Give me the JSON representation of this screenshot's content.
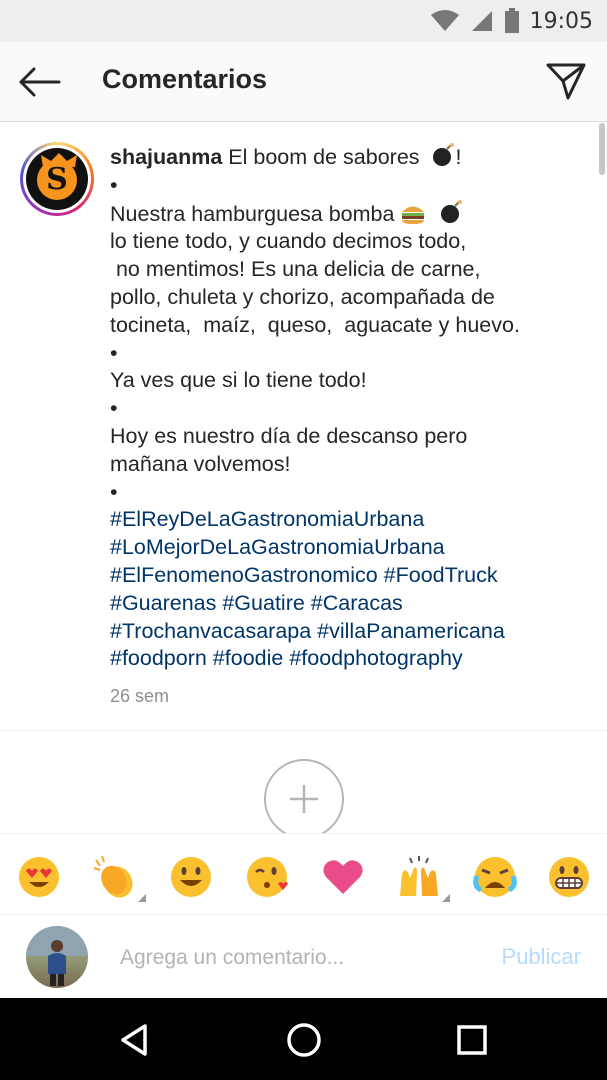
{
  "status_bar": {
    "time": "19:05"
  },
  "header": {
    "title": "Comentarios",
    "back_icon": "arrow-left-icon",
    "send_icon": "paper-plane-icon"
  },
  "caption": {
    "username": "shajuanma",
    "first_line_text": " El boom de sabores",
    "lines": [
      "•",
      "Nuestra hamburguesa bomba",
      "lo tiene todo, y cuando decimos todo,",
      " no mentimos! Es una delicia de carne,",
      "pollo, chuleta y chorizo, acompañada de",
      "tocineta,  maíz,  queso,  aguacate y huevo.",
      "•",
      "Ya ves que si lo tiene todo!",
      "•",
      "Hoy es nuestro día de descanso pero",
      "mañana volvemos!",
      "•"
    ],
    "hashtag_lines": [
      "#ElReyDeLaGastronomiaUrbana",
      "#LoMejorDeLaGastronomiaUrbana",
      "#ElFenomenoGastronomico #FoodTruck",
      "#Guarenas #Guatire #Caracas",
      "#Trochanvacasarapa #villaPanamericana",
      "#foodporn #foodie #foodphotography"
    ],
    "timestamp": "26 sem"
  },
  "emoji_bar": [
    "heart-eyes-emoji-icon",
    "clapping-hands-emoji-icon",
    "grinning-face-emoji-icon",
    "kissing-face-emoji-icon",
    "red-heart-emoji-icon",
    "raising-hands-emoji-icon",
    "crying-face-emoji-icon",
    "grimacing-face-emoji-icon"
  ],
  "composer": {
    "placeholder": "Agrega un comentario...",
    "post_label": "Publicar"
  },
  "colors": {
    "hashtag": "#003569",
    "post_disabled": "#b3dbff",
    "timestamp": "#8e8e8e"
  }
}
